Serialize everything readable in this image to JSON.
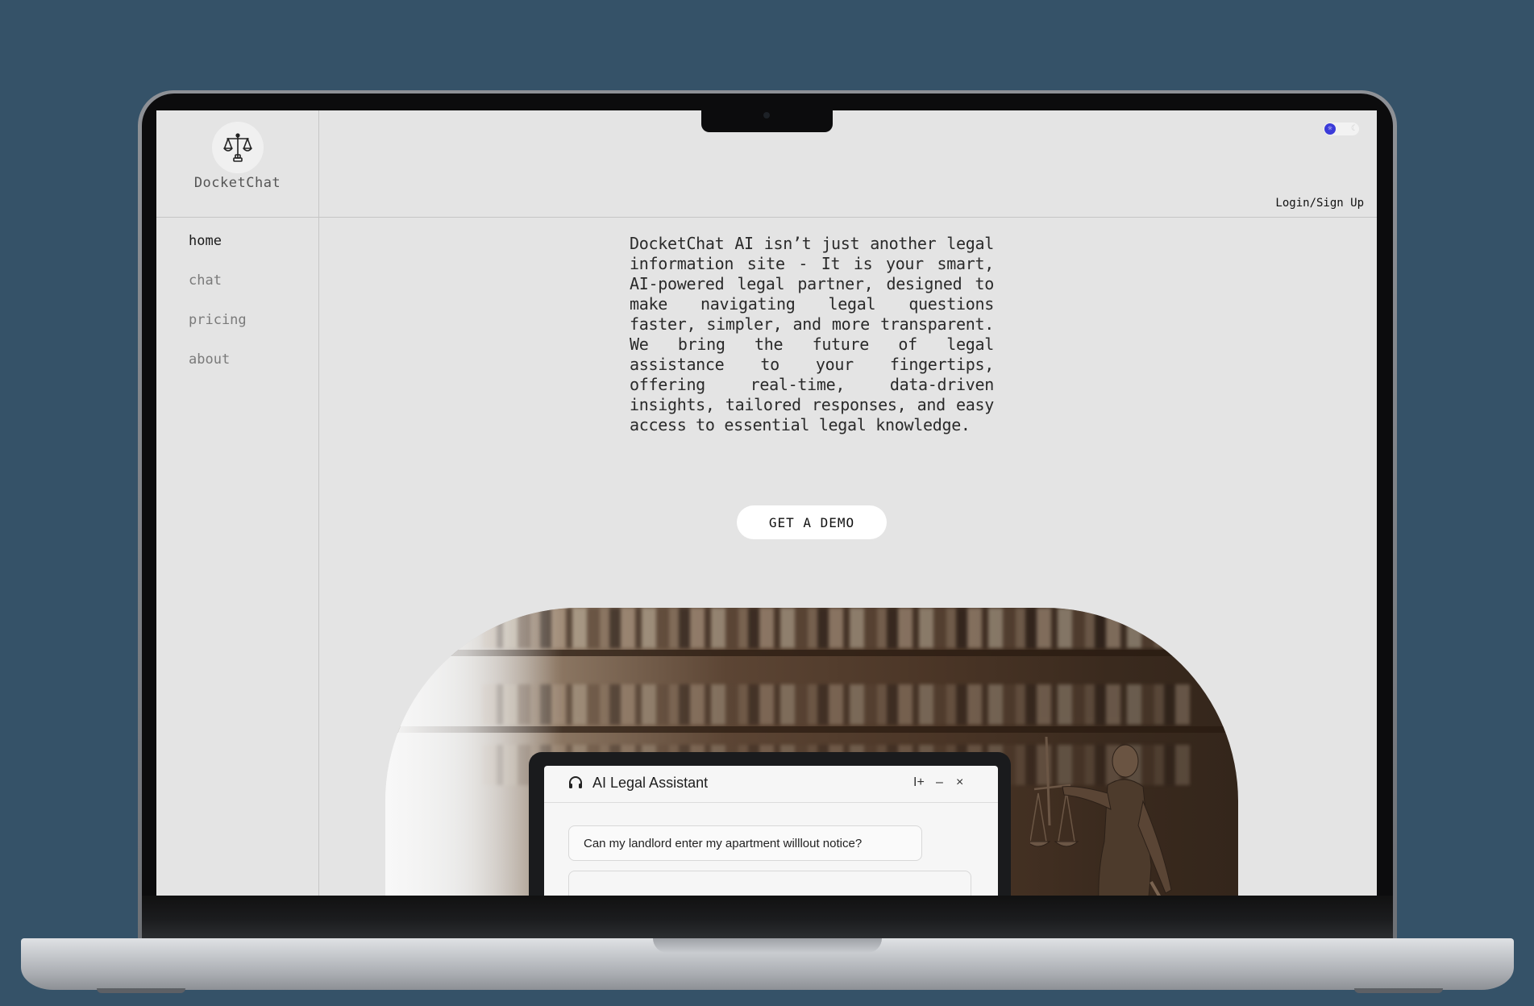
{
  "app": {
    "logo_text": "DocketChat",
    "accent_color": "#3b3bd9",
    "background_color": "#e4e4e4",
    "page_background": "#355268"
  },
  "sidebar": {
    "items": [
      {
        "label": "home",
        "active": true
      },
      {
        "label": "chat",
        "active": false
      },
      {
        "label": "pricing",
        "active": false
      },
      {
        "label": "about",
        "active": false
      }
    ]
  },
  "header": {
    "login_label": "Login/Sign Up",
    "theme_toggle": {
      "state": "light",
      "icons": [
        "sun-icon",
        "moon-icon"
      ]
    }
  },
  "main": {
    "intro_text": "DocketChat AI isn’t just another legal information site - It is your smart, AI-powered legal partner, designed to make navigating legal questions faster, simpler, and more transparent. We bring the future of legal assistance to your fingertips, offering real-time, data-driven insights, tailored responses, and easy access to essential legal knowledge.",
    "cta_label": "GET A DEMO"
  },
  "hero_image": {
    "assistant_title": "AI Legal Assistant",
    "question": "Can my landlord enter my apartment willlout notice?",
    "controls": [
      "I+",
      "–",
      "×"
    ]
  }
}
